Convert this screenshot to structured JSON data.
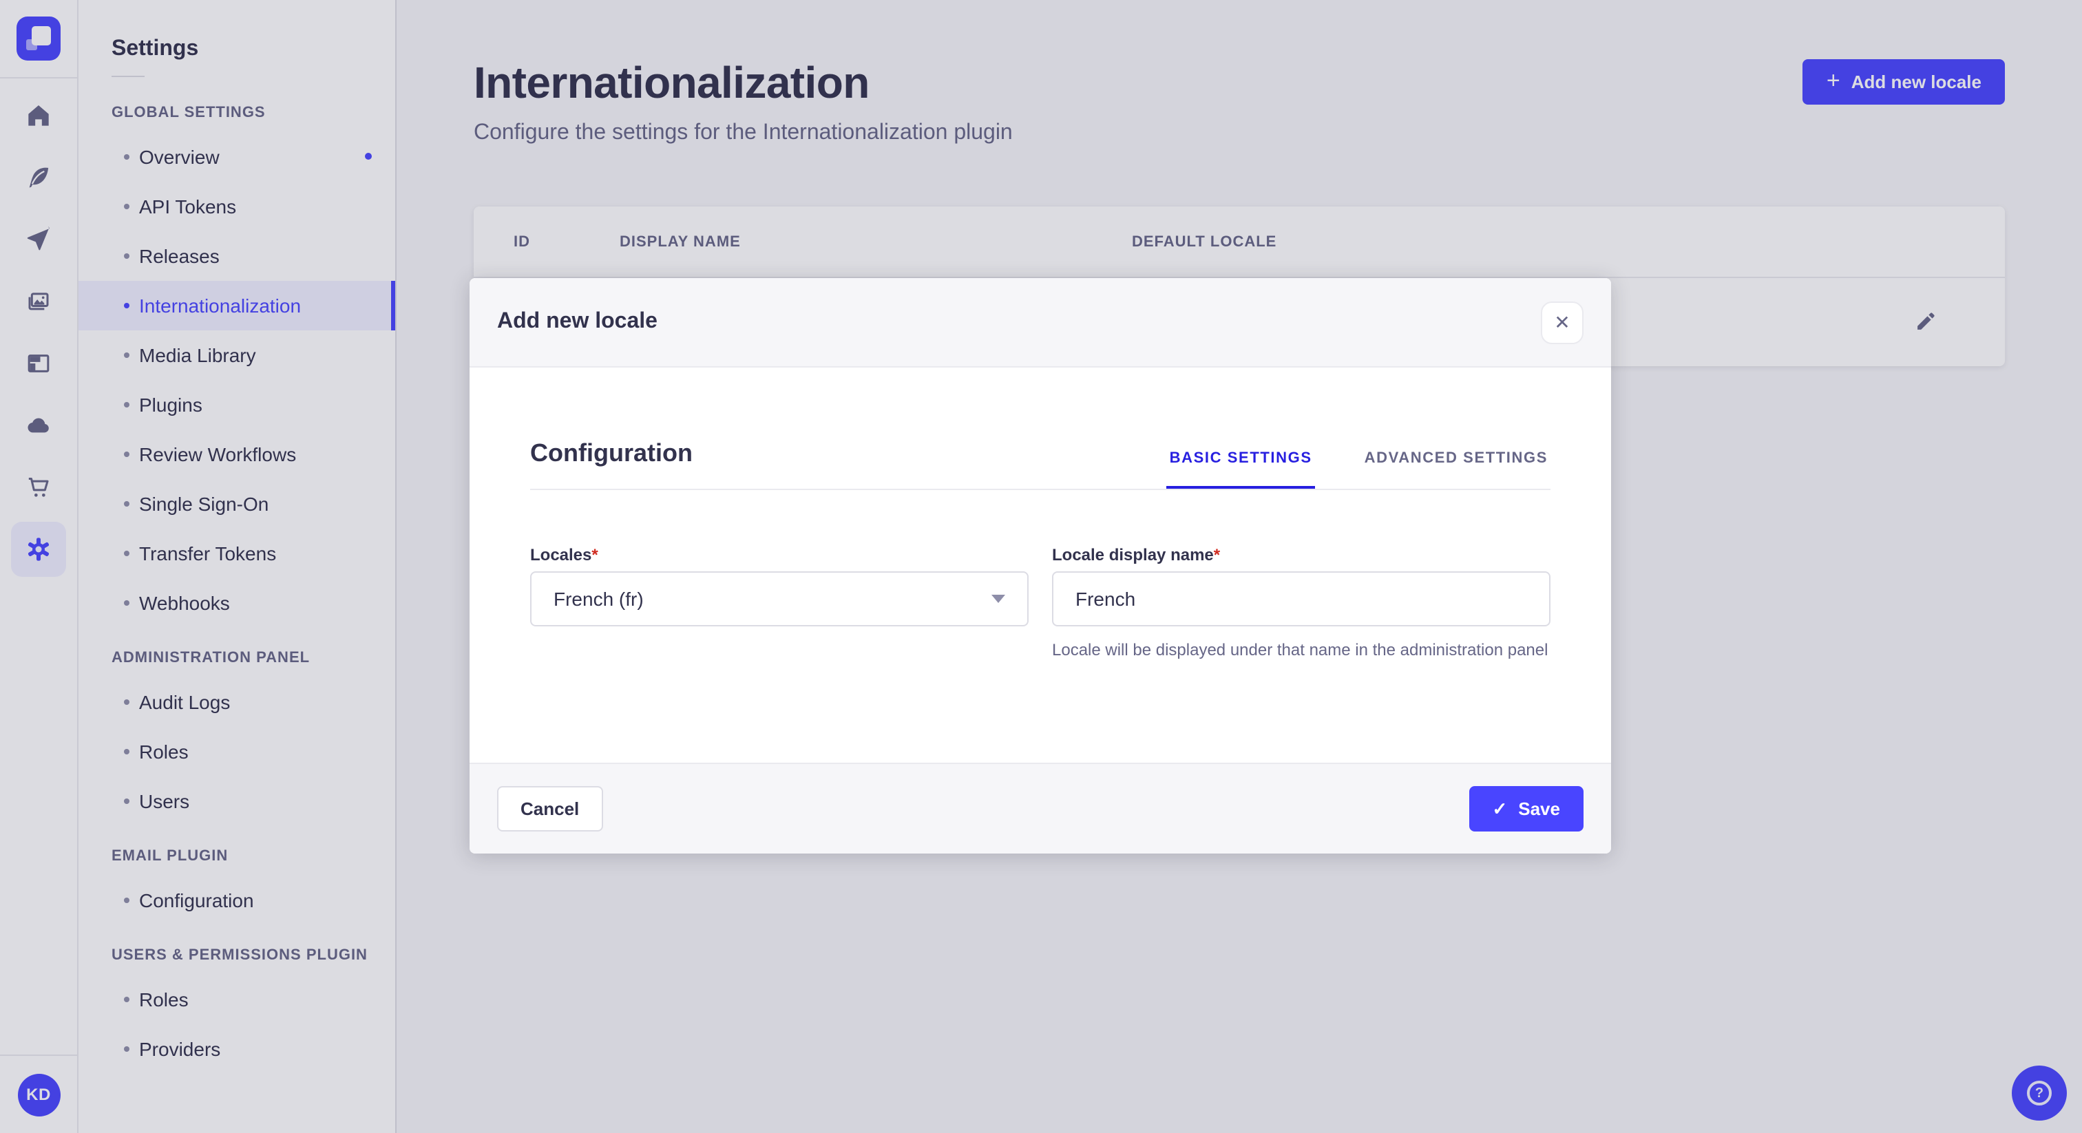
{
  "colors": {
    "primary": "#4945ff",
    "primary_active_tab": "#271fe0",
    "required": "#d02b20",
    "overlay": "rgba(50,50,77,0.17)"
  },
  "rail": {
    "icons": [
      "strapi-logo",
      "home",
      "content-builder",
      "deploy",
      "media-library",
      "content-manager",
      "cloud",
      "marketplace",
      "settings"
    ],
    "avatar_initials": "KD"
  },
  "subnav": {
    "title": "Settings",
    "sections": [
      {
        "label": "GLOBAL SETTINGS",
        "items": [
          {
            "label": "Overview",
            "notification": true
          },
          {
            "label": "API Tokens"
          },
          {
            "label": "Releases"
          },
          {
            "label": "Internationalization",
            "active": true
          },
          {
            "label": "Media Library"
          },
          {
            "label": "Plugins"
          },
          {
            "label": "Review Workflows"
          },
          {
            "label": "Single Sign-On"
          },
          {
            "label": "Transfer Tokens"
          },
          {
            "label": "Webhooks"
          }
        ]
      },
      {
        "label": "ADMINISTRATION PANEL",
        "items": [
          {
            "label": "Audit Logs"
          },
          {
            "label": "Roles"
          },
          {
            "label": "Users"
          }
        ]
      },
      {
        "label": "EMAIL PLUGIN",
        "items": [
          {
            "label": "Configuration"
          }
        ]
      },
      {
        "label": "USERS & PERMISSIONS PLUGIN",
        "items": [
          {
            "label": "Roles"
          },
          {
            "label": "Providers"
          }
        ]
      }
    ]
  },
  "page": {
    "title": "Internationalization",
    "subtitle": "Configure the settings for the Internationalization plugin",
    "add_button": "Add new locale"
  },
  "table": {
    "columns": [
      "ID",
      "DISPLAY NAME",
      "DEFAULT LOCALE"
    ]
  },
  "modal": {
    "title": "Add new locale",
    "section_title": "Configuration",
    "tabs": [
      {
        "label": "BASIC SETTINGS",
        "active": true
      },
      {
        "label": "ADVANCED SETTINGS",
        "active": false
      }
    ],
    "required_marker": "*",
    "fields": {
      "locales": {
        "label": "Locales",
        "value": "French (fr)"
      },
      "display_name": {
        "label": "Locale display name",
        "value": "French",
        "hint": "Locale will be displayed under that name in the administration panel"
      }
    },
    "footer": {
      "cancel": "Cancel",
      "save": "Save"
    }
  },
  "icons": {
    "plus": "+",
    "close": "✕",
    "check": "✓",
    "question": "?"
  }
}
